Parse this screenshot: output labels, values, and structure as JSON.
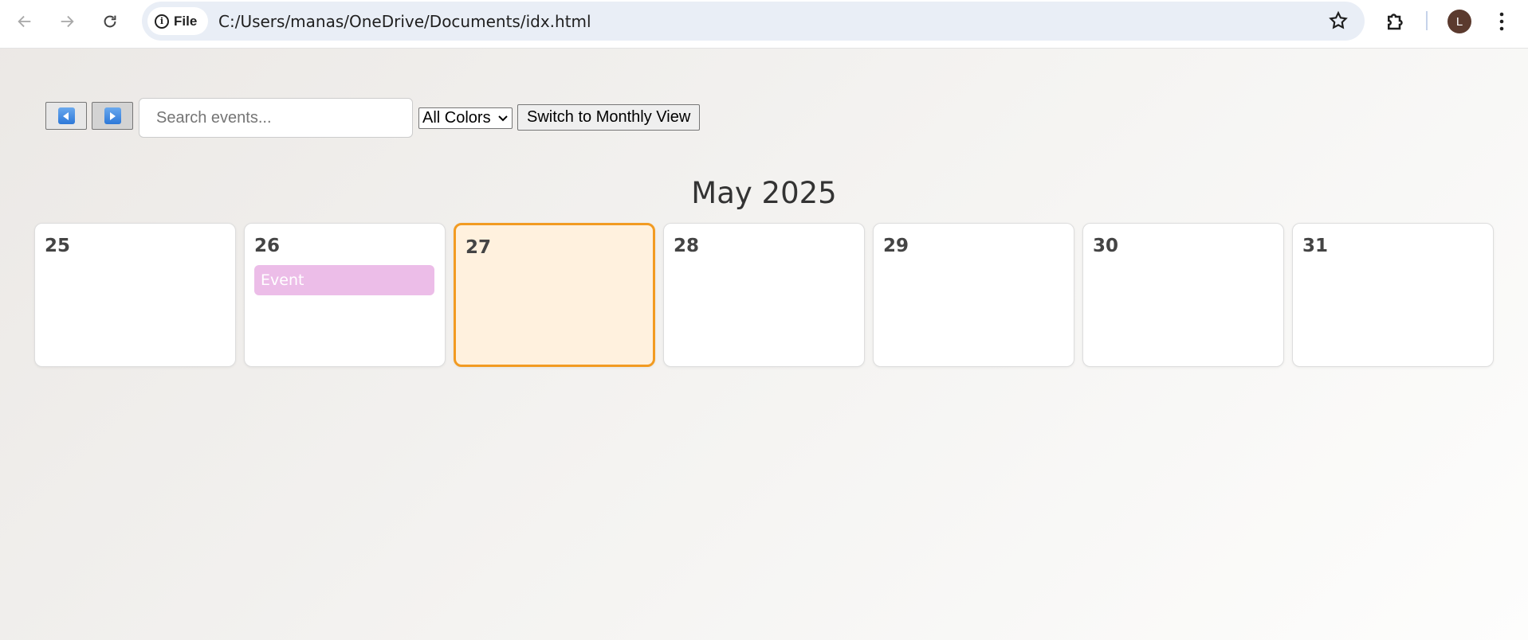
{
  "browser": {
    "site_chip_label": "File",
    "url": "C:/Users/manas/OneDrive/Documents/idx.html",
    "avatar_initial": "L"
  },
  "toolbar": {
    "search_placeholder": "Search events...",
    "color_filter_selected": "All Colors",
    "switch_view_label": "Switch to Monthly View"
  },
  "calendar": {
    "month_title": "May 2025",
    "days": [
      {
        "day": "25",
        "events": []
      },
      {
        "day": "26",
        "events": [
          {
            "label": "Event",
            "color": "#ecbde8"
          }
        ]
      },
      {
        "day": "27",
        "events": [],
        "today": true
      },
      {
        "day": "28",
        "events": []
      },
      {
        "day": "29",
        "events": []
      },
      {
        "day": "30",
        "events": []
      },
      {
        "day": "31",
        "events": []
      }
    ]
  },
  "colors": {
    "today_border": "#f29b22",
    "today_bg": "#fff1de",
    "event_pink": "#ecbde8"
  }
}
